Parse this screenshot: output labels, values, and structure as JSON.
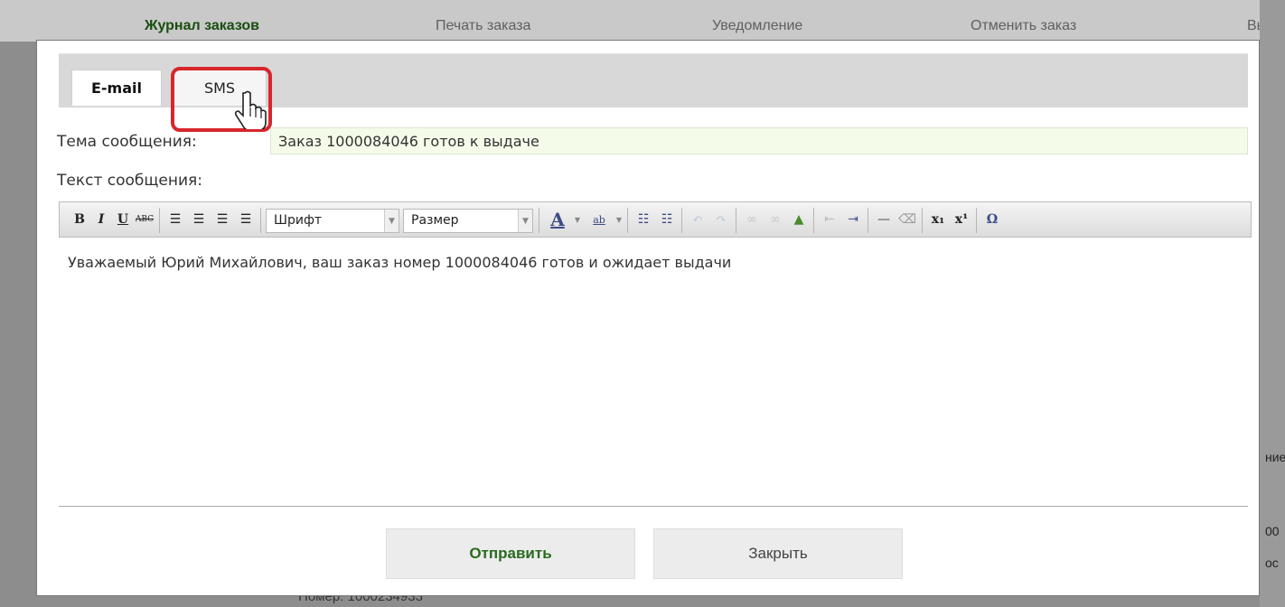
{
  "background": {
    "nav": [
      "Журнал заказов",
      "Печать заказа",
      "Уведомление",
      "Отменить заказ",
      "Выд"
    ],
    "right_fragments": [
      "ние",
      "00",
      "ос"
    ],
    "bottom_fragment": "Номер: 1000234933"
  },
  "dialog": {
    "tabs": [
      "E-mail",
      "SMS"
    ],
    "subject_label": "Тема сообщения:",
    "subject_value": "Заказ 1000084046 готов к выдаче",
    "body_label": "Текст сообщения:",
    "toolbar": {
      "font_select": "Шрифт",
      "size_select": "Размер"
    },
    "body_text": "Уважаемый Юрий Михайлович, ваш заказ номер 1000084046 готов и ожидает выдачи",
    "send_button": "Отправить",
    "close_button": "Закрыть"
  },
  "colors": {
    "highlight": "#d7262c",
    "send_text": "#2a6a1f",
    "subject_bg": "#f5fbe9"
  },
  "icons": [
    "bold-icon",
    "italic-icon",
    "underline-icon",
    "strikethrough-icon",
    "align-left-icon",
    "align-center-icon",
    "align-right-icon",
    "align-justify-icon",
    "text-color-icon",
    "background-color-icon",
    "bullet-list-icon",
    "numbered-list-icon",
    "undo-icon",
    "redo-icon",
    "link-icon",
    "unlink-icon",
    "image-icon",
    "outdent-icon",
    "indent-icon",
    "horizontal-rule-icon",
    "remove-format-icon",
    "subscript-icon",
    "superscript-icon",
    "special-char-icon",
    "hand-cursor-icon"
  ]
}
